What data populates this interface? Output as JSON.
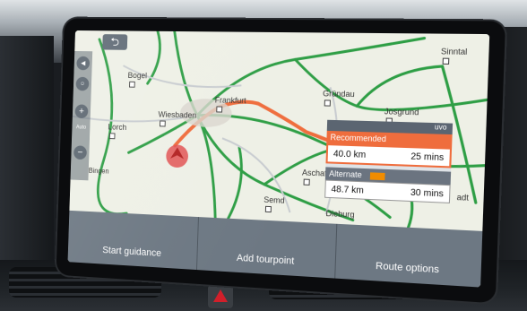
{
  "controls": {
    "back_icon": "⮌",
    "zoom_in_icon": "+",
    "zoom_out_icon": "−",
    "auto_label": "Auto"
  },
  "map": {
    "places": [
      {
        "name": "Bogel"
      },
      {
        "name": "Lorch"
      },
      {
        "name": "Wiesbaden"
      },
      {
        "name": "Frankfurt"
      },
      {
        "name": "Gründau"
      },
      {
        "name": "Sinntal"
      },
      {
        "name": "Josgrund"
      },
      {
        "name": "Aschaffen"
      },
      {
        "name": "Semd"
      },
      {
        "name": "Bingen"
      },
      {
        "name": "Dieburg"
      },
      {
        "name": "adt"
      }
    ]
  },
  "route_panel": {
    "header": "uvo",
    "recommended": {
      "label": "Recommended",
      "distance": "40.0 km",
      "duration": "25 mins"
    },
    "alternate": {
      "label": "Alternate",
      "distance": "48.7 km",
      "duration": "30 mins"
    }
  },
  "actions": {
    "start": "Start guidance",
    "add_tour": "Add tourpoint",
    "options": "Route options"
  },
  "colors": {
    "recommended_accent": "#ef6d3d",
    "road_green": "#2e9e45",
    "route_orange": "#ef6d3d",
    "button_grey": "#6d7883"
  }
}
